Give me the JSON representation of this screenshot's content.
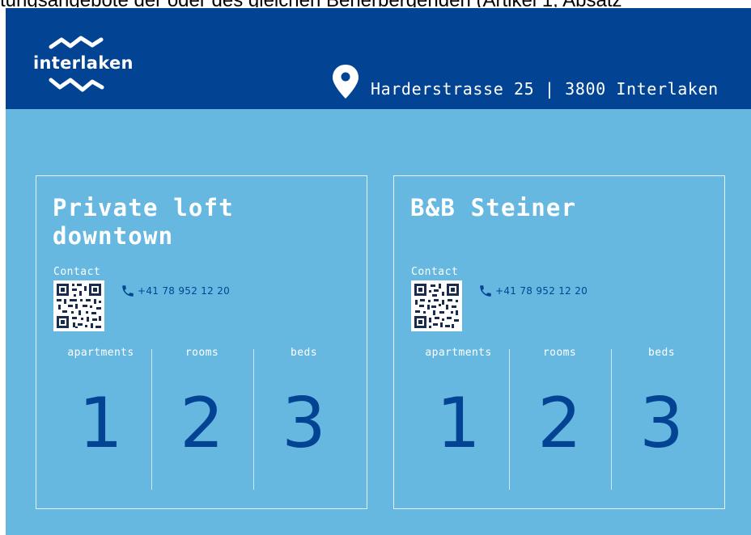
{
  "top_text": {
    "underlined": "tungsangebote der oder des gleichen Beherbergenden",
    "rest": " (Artikel 1, Absatz"
  },
  "header": {
    "logo_text": "interlaken",
    "address": "Harderstrasse 25 | 3800 Interlaken"
  },
  "colors": {
    "header_bg": "#024493",
    "panel_bg": "#66b8e1",
    "accent_dark": "#024493"
  },
  "icons": [
    "map-pin-icon",
    "phone-icon",
    "qr-code-icon"
  ],
  "cards": [
    {
      "title": "Private loft downtown",
      "contact_label": "Contact",
      "phone": "+41 78 952 12 20",
      "stats": [
        {
          "label": "apartments",
          "value": "1"
        },
        {
          "label": "rooms",
          "value": "2"
        },
        {
          "label": "beds",
          "value": "3"
        }
      ]
    },
    {
      "title": "B&B Steiner",
      "contact_label": "Contact",
      "phone": "+41 78 952 12 20",
      "stats": [
        {
          "label": "apartments",
          "value": "1"
        },
        {
          "label": "rooms",
          "value": "2"
        },
        {
          "label": "beds",
          "value": "3"
        }
      ]
    }
  ]
}
